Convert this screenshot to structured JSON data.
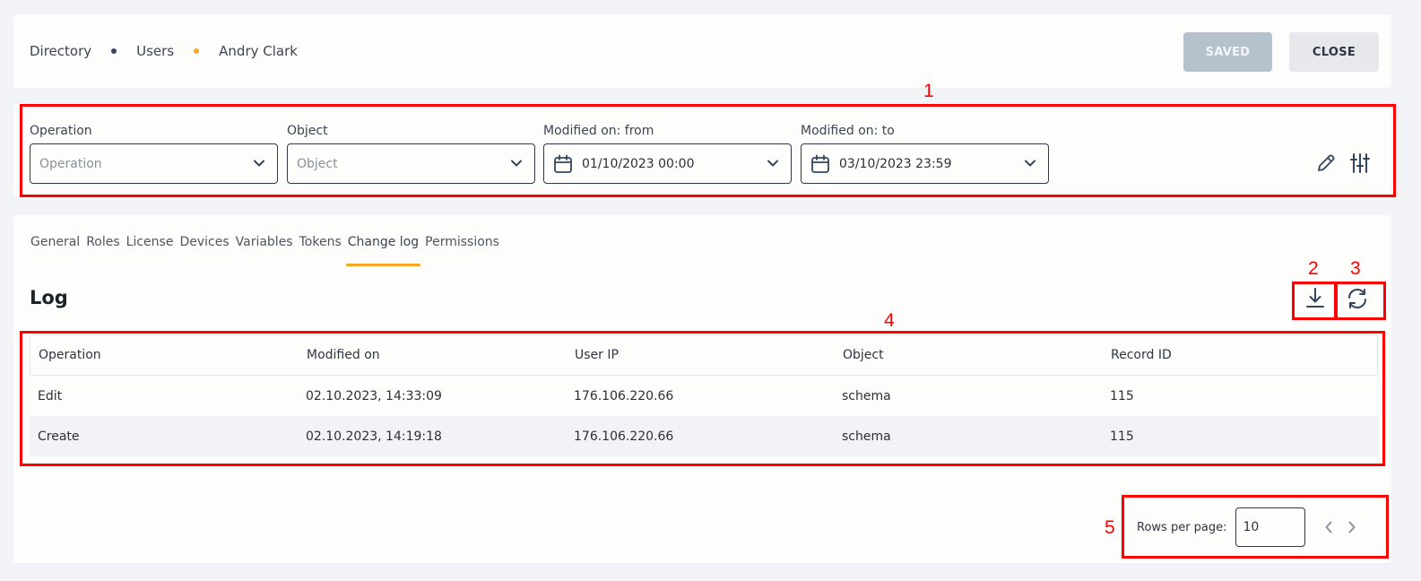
{
  "breadcrumb": {
    "items": [
      "Directory",
      "Users",
      "Andry Clark"
    ],
    "dot_colors": [
      "#33455e",
      "#f5a623"
    ]
  },
  "header": {
    "saved_label": "SAVED",
    "close_label": "CLOSE"
  },
  "filters": {
    "operation": {
      "label": "Operation",
      "placeholder": "Operation"
    },
    "object": {
      "label": "Object",
      "placeholder": "Object"
    },
    "modified_from": {
      "label": "Modified on: from",
      "value": "01/10/2023 00:00"
    },
    "modified_to": {
      "label": "Modified on: to",
      "value": "03/10/2023 23:59"
    }
  },
  "tabs": [
    "General",
    "Roles",
    "License",
    "Devices",
    "Variables",
    "Tokens",
    "Change log",
    "Permissions"
  ],
  "active_tab": "Change log",
  "log": {
    "title": "Log",
    "columns": [
      "Operation",
      "Modified on",
      "User IP",
      "Object",
      "Record ID"
    ],
    "rows": [
      [
        "Edit",
        "02.10.2023, 14:33:09",
        "176.106.220.66",
        "schema",
        "115"
      ],
      [
        "Create",
        "02.10.2023, 14:19:18",
        "176.106.220.66",
        "schema",
        "115"
      ]
    ]
  },
  "pagination": {
    "rows_label": "Rows per page:",
    "rows_value": "10"
  },
  "annotations": [
    "1",
    "2",
    "3",
    "4",
    "5"
  ],
  "colors": {
    "accent": "#f5a623",
    "annotation": "#ff0000",
    "icon": "#33455e"
  },
  "icons": [
    "calendar-icon",
    "chevron-down-icon",
    "pencil-icon",
    "sliders-icon",
    "download-icon",
    "refresh-icon",
    "chevron-left-icon",
    "chevron-right-icon"
  ]
}
